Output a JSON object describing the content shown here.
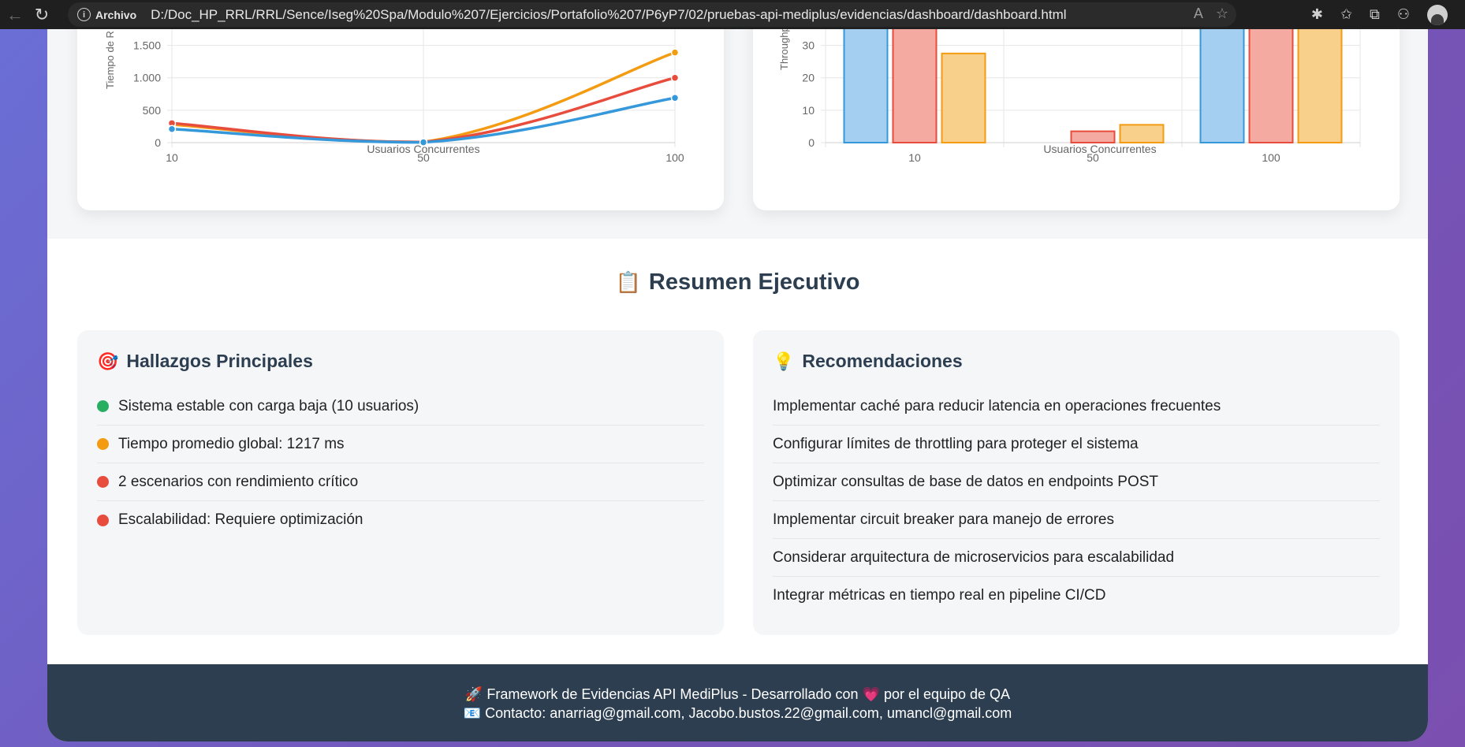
{
  "browser": {
    "site_label": "Archivo",
    "url": "D:/Doc_HP_RRL/RRL/Sence/Iseg%20Spa/Modulo%207/Ejercicios/Portafolio%207/P6yP7/02/pruebas-api-mediplus/evidencias/dashboard/dashboard.html"
  },
  "response_chart": {
    "ylabel": "Tiempo de R",
    "xlabel": "Usuarios Concurrentes",
    "y_ticks": [
      "0",
      "500",
      "1.000",
      "1.500"
    ],
    "x_ticks": [
      "10",
      "50",
      "100"
    ]
  },
  "throughput_chart": {
    "ylabel": "Throughp",
    "xlabel": "Usuarios Concurrentes",
    "y_ticks": [
      "0",
      "10",
      "20",
      "30"
    ],
    "x_ticks": [
      "10",
      "50",
      "100"
    ]
  },
  "chart_data": [
    {
      "type": "line",
      "xlabel": "Usuarios Concurrentes",
      "ylabel": "Tiempo de R",
      "x": [
        10,
        50,
        100
      ],
      "ylim": [
        0,
        1750
      ],
      "series": [
        {
          "color": "#f39c12",
          "values": [
            280,
            10,
            1390
          ]
        },
        {
          "color": "#e74c3c",
          "values": [
            300,
            10,
            1000
          ]
        },
        {
          "color": "#3498db",
          "values": [
            210,
            5,
            690
          ]
        }
      ]
    },
    {
      "type": "bar",
      "xlabel": "Usuarios Concurrentes",
      "ylabel": "Throughp",
      "categories": [
        "10",
        "50",
        "100"
      ],
      "ylim": [
        0,
        35
      ],
      "series": [
        {
          "color": "#3498db",
          "fill": "#a5cff0",
          "values": [
            40,
            0,
            40
          ]
        },
        {
          "color": "#e74c3c",
          "fill": "#f4a9a1",
          "values": [
            40,
            3.5,
            40
          ]
        },
        {
          "color": "#f39c12",
          "fill": "#f8d08b",
          "values": [
            27.5,
            5.5,
            40
          ]
        }
      ]
    }
  ],
  "summary": {
    "emoji": "📋",
    "title": "Resumen Ejecutivo"
  },
  "findings": {
    "emoji": "🎯",
    "title": "Hallazgos Principales",
    "items": [
      {
        "text": "Sistema estable con carga baja (10 usuarios)",
        "color": "#27ae60"
      },
      {
        "text": "Tiempo promedio global: 1217 ms",
        "color": "#f39c12"
      },
      {
        "text": "2 escenarios con rendimiento crítico",
        "color": "#e74c3c"
      },
      {
        "text": "Escalabilidad: Requiere optimización",
        "color": "#e74c3c"
      }
    ]
  },
  "recommendations": {
    "emoji": "💡",
    "title": "Recomendaciones",
    "items": [
      "Implementar caché para reducir latencia en operaciones frecuentes",
      "Configurar límites de throttling para proteger el sistema",
      "Optimizar consultas de base de datos en endpoints POST",
      "Implementar circuit breaker para manejo de errores",
      "Considerar arquitectura de microservicios para escalabilidad",
      "Integrar métricas en tiempo real en pipeline CI/CD"
    ]
  },
  "footer": {
    "line1": "🚀 Framework de Evidencias API MediPlus - Desarrollado con 💗 por el equipo de QA",
    "line2": "📧 Contacto: anarriag@gmail.com, Jacobo.bustos.22@gmail.com, umancl@gmail.com"
  }
}
